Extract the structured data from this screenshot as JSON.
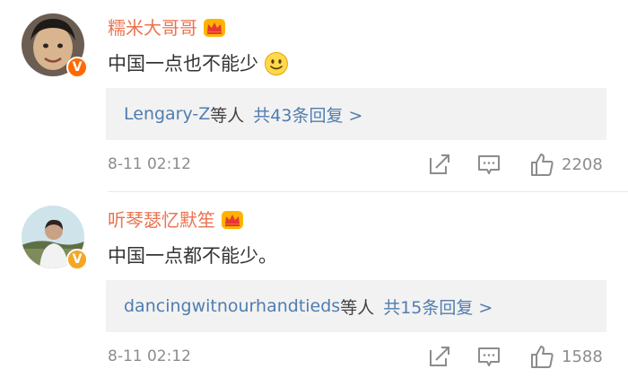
{
  "comments": [
    {
      "user": "糯米大哥哥",
      "text": "中国一点也不能少",
      "badge": "V",
      "reply_users": "Lengary-Z",
      "reply_suffix": "等人",
      "reply_count": "共43条回复 >",
      "time": "8-11 02:12",
      "likes": "2208"
    },
    {
      "user": "听琴瑟忆默笙",
      "text": "中国一点都不能少。",
      "badge": "V",
      "reply_users": "dancingwitnourhandtieds",
      "reply_suffix": "等人",
      "reply_count": "共15条回复 >",
      "time": "8-11 02:12",
      "likes": "1588"
    }
  ],
  "icons": {
    "crown": "crown-icon",
    "smile": "smile-emoji-icon",
    "share": "share-icon",
    "reply": "comment-icon",
    "like": "thumbs-up-icon"
  },
  "colors": {
    "username": "#eb7350",
    "link": "#507daf",
    "text": "#333333",
    "meta": "#8c8c8c",
    "reply_bg": "#f2f2f2"
  }
}
